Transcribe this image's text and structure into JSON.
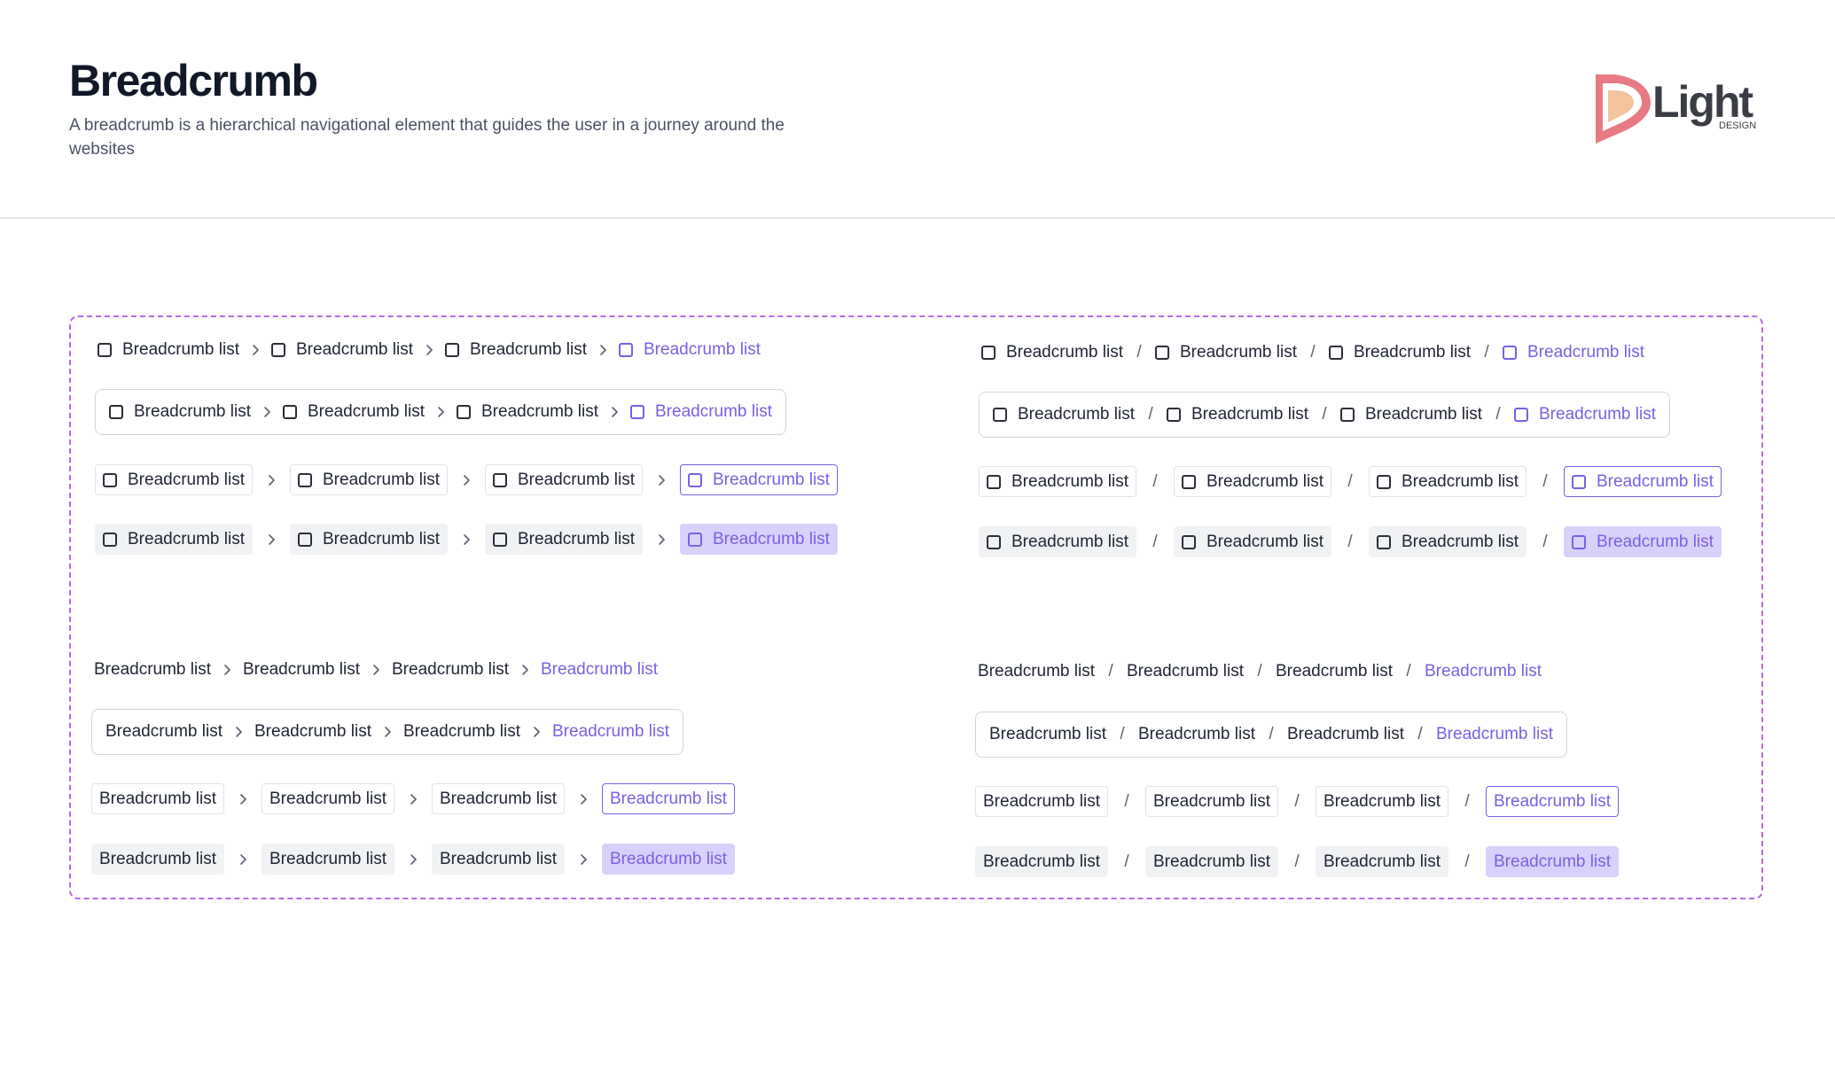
{
  "header": {
    "title": "Breadcrumb",
    "description": "A breadcrumb is a hierarchical navigational element that guides the user in a journey around the websites"
  },
  "logo": {
    "word": "Light",
    "sub": "DESIGN",
    "colors": {
      "outer": "#e87a83",
      "inner": "#f2c39c",
      "text": "#3b3d45"
    }
  },
  "colors": {
    "accent": "#7b5fe3",
    "board_border": "#b46ae8"
  },
  "breadcrumb": {
    "items": [
      "Breadcrumb list",
      "Breadcrumb list",
      "Breadcrumb list",
      "Breadcrumb list"
    ],
    "active_index": 3,
    "chevron_icon": "chevron-right-icon",
    "slash_separator": "/"
  }
}
